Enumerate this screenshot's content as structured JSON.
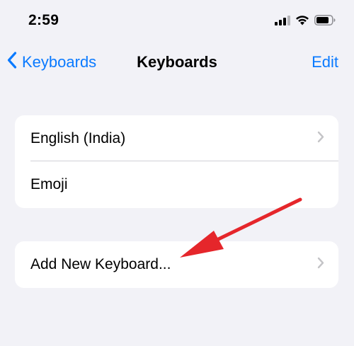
{
  "status_bar": {
    "time": "2:59"
  },
  "nav": {
    "back_label": "Keyboards",
    "title": "Keyboards",
    "edit_label": "Edit"
  },
  "keyboards": {
    "items": [
      {
        "label": "English (India)",
        "has_chevron": true
      },
      {
        "label": "Emoji",
        "has_chevron": false
      }
    ]
  },
  "add_keyboard": {
    "label": "Add New Keyboard..."
  },
  "colors": {
    "accent": "#0a7aff",
    "background": "#f2f2f7",
    "annotation_arrow": "#e5262b"
  },
  "icons": [
    "cellular-signal-icon",
    "wifi-icon",
    "battery-icon",
    "chevron-left-icon",
    "chevron-right-icon",
    "arrow-annotation"
  ]
}
